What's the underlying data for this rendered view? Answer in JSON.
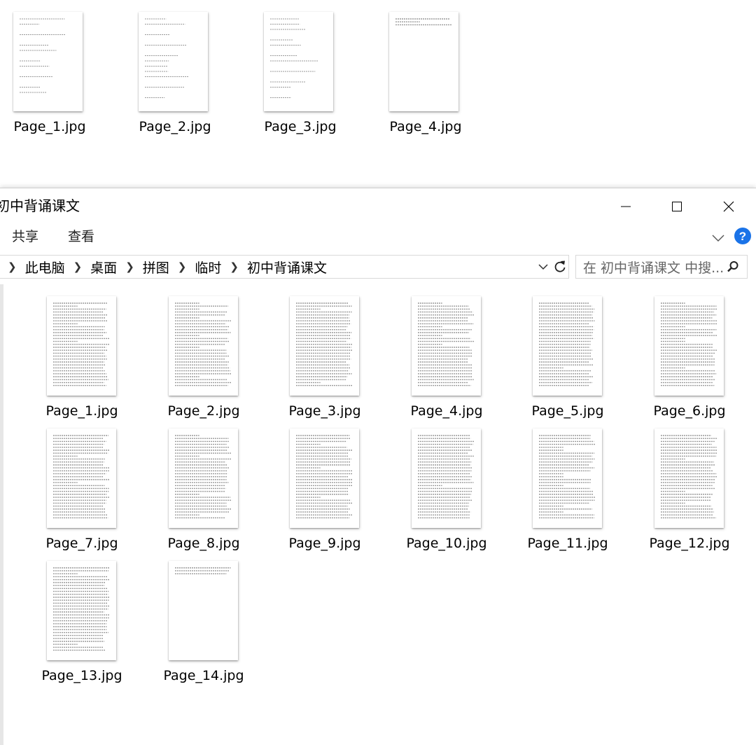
{
  "background_window": {
    "files": [
      "Page_1.jpg",
      "Page_2.jpg",
      "Page_3.jpg",
      "Page_4.jpg"
    ]
  },
  "window": {
    "title": "初中背诵课文",
    "controls": {
      "minimize": "—",
      "maximize": "☐",
      "close": "✕"
    }
  },
  "ribbon": {
    "tabs": [
      "共享",
      "查看"
    ],
    "expand_icon": "chevron-down-icon",
    "help_icon": "help-icon"
  },
  "address": {
    "breadcrumbs": [
      "此电脑",
      "桌面",
      "拼图",
      "临时",
      "初中背诵课文"
    ],
    "refresh_icon": "refresh-icon"
  },
  "search": {
    "placeholder": "在 初中背诵课文 中搜..."
  },
  "files": [
    "Page_1.jpg",
    "Page_2.jpg",
    "Page_3.jpg",
    "Page_4.jpg",
    "Page_5.jpg",
    "Page_6.jpg",
    "Page_7.jpg",
    "Page_8.jpg",
    "Page_9.jpg",
    "Page_10.jpg",
    "Page_11.jpg",
    "Page_12.jpg",
    "Page_13.jpg",
    "Page_14.jpg"
  ],
  "colors": {
    "help_blue": "#1a73e8",
    "text": "#000000",
    "border": "#d9d9d9"
  }
}
